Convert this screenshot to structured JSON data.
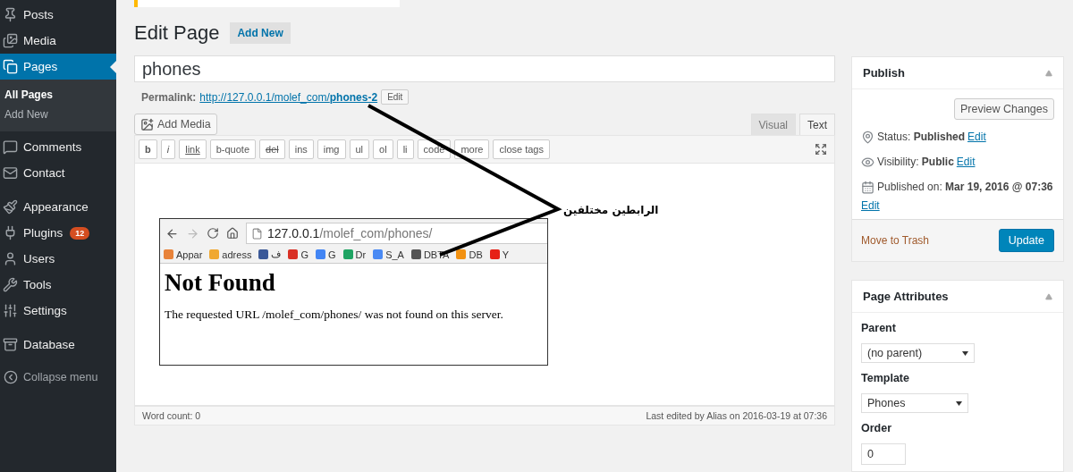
{
  "sidebar": {
    "groups": [
      [
        {
          "label": "Posts",
          "selected": false
        },
        {
          "label": "Media",
          "selected": false
        },
        {
          "label": "Pages",
          "selected": true,
          "children": [
            {
              "label": "All Pages",
              "selected": true
            },
            {
              "label": "Add New",
              "selected": false
            }
          ]
        },
        {
          "label": "Comments",
          "selected": false
        },
        {
          "label": "Contact",
          "selected": false
        }
      ],
      [
        {
          "label": "Appearance",
          "selected": false
        },
        {
          "label": "Plugins",
          "selected": false,
          "badge": "12"
        },
        {
          "label": "Users",
          "selected": false
        },
        {
          "label": "Tools",
          "selected": false
        },
        {
          "label": "Settings",
          "selected": false
        }
      ],
      [
        {
          "label": "Database",
          "selected": false
        }
      ]
    ],
    "collapse": "Collapse menu"
  },
  "header": {
    "title": "Edit Page",
    "add_new": "Add New"
  },
  "editor": {
    "title_value": "phones",
    "permalink": {
      "label": "Permalink:",
      "url": "http://127.0.0.1/molef_com/**phones-2**",
      "edit": "Edit"
    },
    "add_media": "Add Media",
    "tabs": [
      {
        "label": "Visual",
        "selected": false
      },
      {
        "label": "Text",
        "selected": true
      }
    ],
    "quicktags": [
      {
        "label": "b",
        "kind": "bold"
      },
      {
        "label": "i",
        "kind": "italic"
      },
      {
        "label": "link",
        "kind": "link"
      },
      {
        "label": "b-quote",
        "kind": "plain"
      },
      {
        "label": "del",
        "kind": "del"
      },
      {
        "label": "ins",
        "kind": "plain"
      },
      {
        "label": "img",
        "kind": "plain"
      },
      {
        "label": "ul",
        "kind": "plain"
      },
      {
        "label": "ol",
        "kind": "plain"
      },
      {
        "label": "li",
        "kind": "plain"
      },
      {
        "label": "code",
        "kind": "plain"
      },
      {
        "label": "more",
        "kind": "plain"
      },
      {
        "label": "close tags",
        "kind": "plain"
      }
    ],
    "browser": {
      "address_host": "127.0.0.1",
      "address_path": "/molef_com/phones/",
      "bookmarks": [
        {
          "label": "Appar",
          "color": "#e8833a"
        },
        {
          "label": "adress",
          "color": "#f0a830"
        },
        {
          "label": "ف",
          "color": "#3b5998"
        },
        {
          "label": "G",
          "color": "#d93025"
        },
        {
          "label": "G",
          "color": "#4285f4"
        },
        {
          "label": "Dr",
          "color": "#1fa463"
        },
        {
          "label": "S_A",
          "color": "#4a8af4"
        },
        {
          "label": "DBTA",
          "color": "#555555"
        },
        {
          "label": "DB",
          "color": "#f29111"
        },
        {
          "label": "Y",
          "color": "#e62117"
        }
      ],
      "heading": "Not Found",
      "message": "The requested URL /molef_com/phones/ was not found on this server."
    },
    "footer": {
      "word_count": "Word count: 0",
      "last_edited": "Last edited by Alias on 2016-03-19 at 07:36"
    }
  },
  "annotation": "الرابطين مختلفين",
  "publish": {
    "title": "Publish",
    "preview": "Preview Changes",
    "rows": [
      {
        "text": "Status: **Published**",
        "edit": "Edit"
      },
      {
        "text": "Visibility: **Public**",
        "edit": "Edit"
      },
      {
        "text": "Published on: **Mar 19, 2016 @ 07:36**",
        "edit": "Edit"
      }
    ],
    "trash": "Move to Trash",
    "update": "Update"
  },
  "attributes": {
    "title": "Page Attributes",
    "parent_label": "Parent",
    "parent_value": "(no parent)",
    "template_label": "Template",
    "template_value": "Phones",
    "order_label": "Order",
    "order_value": "0"
  }
}
